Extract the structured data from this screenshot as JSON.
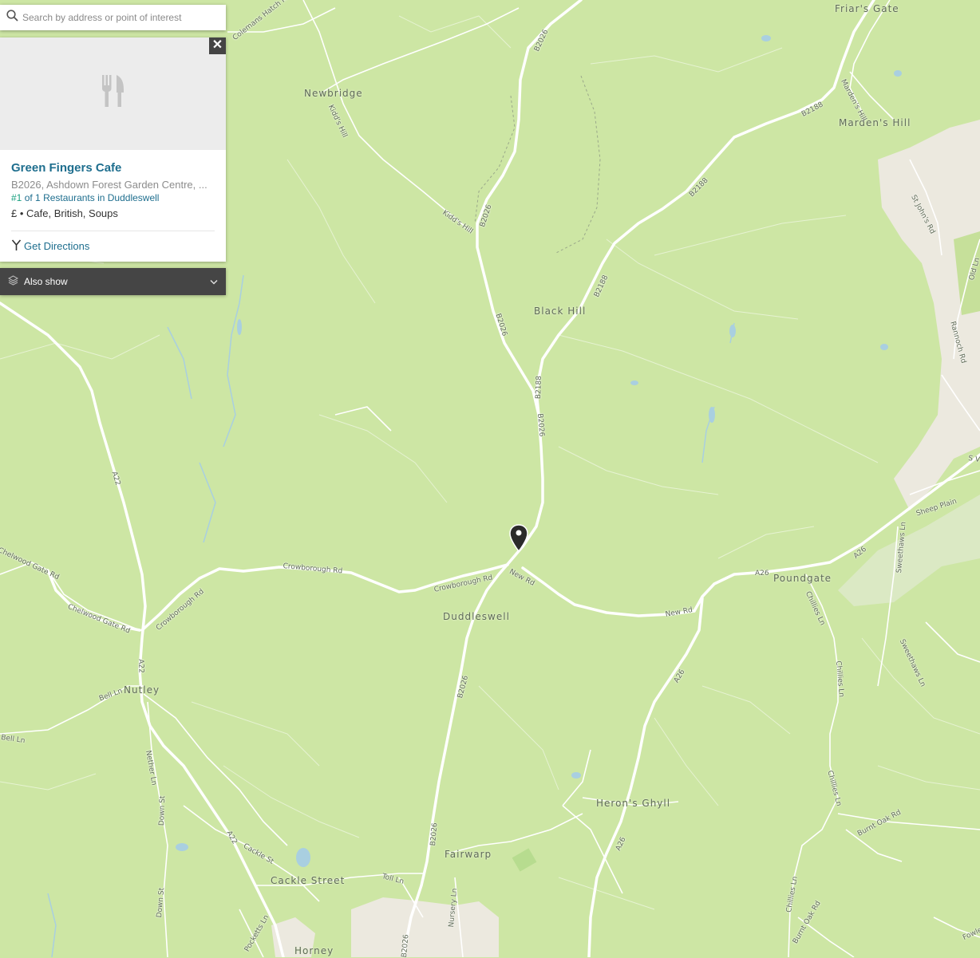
{
  "search": {
    "placeholder": "Search by address or point of interest"
  },
  "poi": {
    "icon": "restaurant-fork-knife-icon",
    "close_label": "✕",
    "name": "Green Fingers Cafe",
    "address": "B2026, Ashdown Forest Garden Centre, ...",
    "rank_number": "#1",
    "rank_of": "of 1",
    "rank_category": "Restaurants in Duddleswell",
    "tags": "£ • Cafe, British, Soups",
    "directions_label": "Get Directions"
  },
  "also_show": {
    "label": "Also show"
  },
  "map": {
    "colors": {
      "land": "#cde6a4",
      "road": "#ffffff",
      "urban": "#ece9df",
      "water": "#a9cfe0",
      "marker": "#2b2b2b"
    },
    "places": {
      "friars_gate": "Friar's Gate",
      "newbridge": "Newbridge",
      "mardens_hill": "Marden's Hill",
      "black_hill": "Black Hill",
      "duddleswell": "Duddleswell",
      "poundgate": "Poundgate",
      "nutley": "Nutley",
      "herons_ghyll": "Heron's Ghyll",
      "fairwarp": "Fairwarp",
      "cackle_street": "Cackle Street",
      "horney": "Horney"
    },
    "roads": {
      "b2026_a": "B2026",
      "b2026_b": "B2026",
      "b2026_c": "B2026",
      "b2026_d": "B2026",
      "b2026_e": "B2026",
      "b2026_f": "B2026",
      "b2026_g": "B2026",
      "b2188_a": "B2188",
      "b2188_b": "B2188",
      "b2188_c": "B2188",
      "b2188_d": "B2188",
      "a22_a": "A22",
      "a22_b": "A22",
      "a22_c": "A22",
      "a26_a": "A26",
      "a26_b": "A26",
      "a26_c": "A26",
      "a26_d": "A26",
      "crowborough_rd_a": "Crowborough Rd",
      "crowborough_rd_b": "Crowborough Rd",
      "crowborough_rd_c": "Crowborough Rd",
      "new_rd_a": "New Rd",
      "new_rd_b": "New Rd",
      "chelwood_gate_rd_a": "Chelwood Gate Rd",
      "chelwood_gate_rd_b": "Chelwood Gate Rd",
      "kidds_hill_a": "Kidd's Hill",
      "kidds_hill_b": "Kidd's Hill",
      "colemans_hatch": "Colemans Hatch R",
      "mardens_hill_rd": "Marden's Hill",
      "st_johns_rd": "St John's Rd",
      "old_ln": "Old Ln",
      "rannoch_rd": "Rannoch Rd",
      "sheep_plain": "Sheep Plain",
      "sweethaws_ln_a": "Sweethaws Ln",
      "sweethaws_ln_b": "Sweethaws Ln",
      "chillies_ln_a": "Chillies Ln",
      "chillies_ln_b": "Chillies Ln",
      "chillies_ln_c": "Chillies Ln",
      "chillies_ln_d": "Chillies Ln",
      "bell_ln_a": "Bell Ln",
      "bell_ln_b": "Bell Ln",
      "nether_ln": "Nether Ln",
      "down_st_a": "Down St",
      "down_st_b": "Down St",
      "cackle_st": "Cackle St",
      "toll_ln": "Toll Ln",
      "nursery_ln": "Nursery Ln",
      "pocketts_ln": "Pocketts Ln",
      "burnt_oak_rd_a": "Burnt Oak Rd",
      "burnt_oak_rd_b": "Burnt Oak Rd",
      "fowle": "Fowle",
      "s_v": "S V"
    }
  }
}
